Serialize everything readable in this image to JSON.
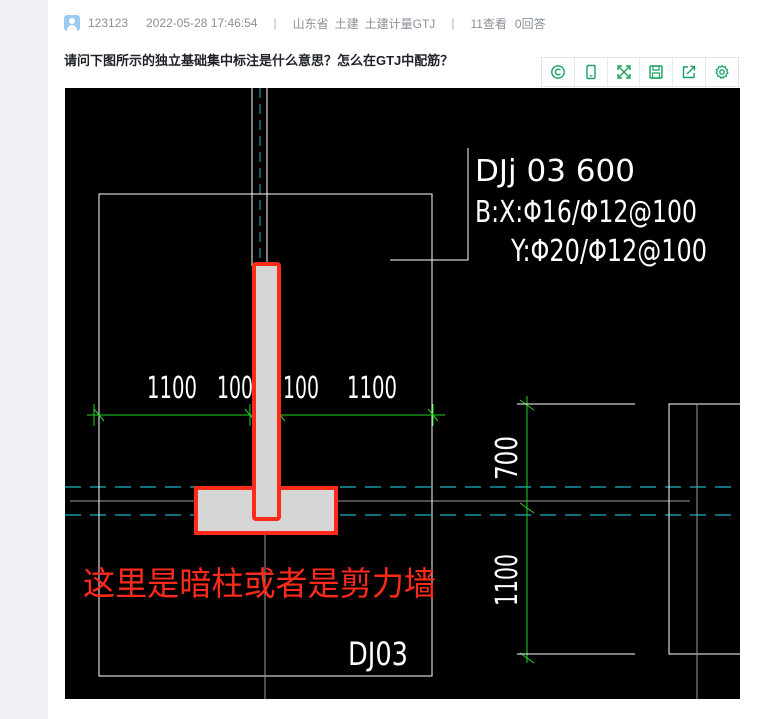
{
  "question": {
    "author": "123123",
    "datetime": "2022-05-28 17:46:54",
    "separator": "|",
    "province": "山东省",
    "category": "土建",
    "software": "土建计量GTJ",
    "views": "11查看",
    "answers": "0回答",
    "title": "请问下图所示的独立基础集中标注是什么意思？怎么在GTJ中配筋？"
  },
  "toolbar": {
    "icons": [
      "ocr-icon",
      "phone-icon",
      "fullscreen-icon",
      "save-icon",
      "share-icon",
      "settings-icon"
    ],
    "color": "#19a162"
  },
  "drawing": {
    "label_line1": "DJj 03   600",
    "label_line2": "B:X:Φ16/Φ12@100",
    "label_line3": "Y:Φ20/Φ12@100",
    "dim_1100_left": "1100",
    "dim_100_left": "100",
    "dim_100_right": "100",
    "dim_1100_right": "1100",
    "dim_700_vertical": "700",
    "dim_1100_vertical": "1100",
    "annotation": "这里是暗柱或者是剪力墙",
    "foundation_name": "DJ03",
    "colors": {
      "background": "#000000",
      "lines": "#ffffff",
      "dimension": "#22d422",
      "axis": "#19b4c4",
      "highlight": "#ff2a1a",
      "fill": "#d6d6d6"
    }
  }
}
